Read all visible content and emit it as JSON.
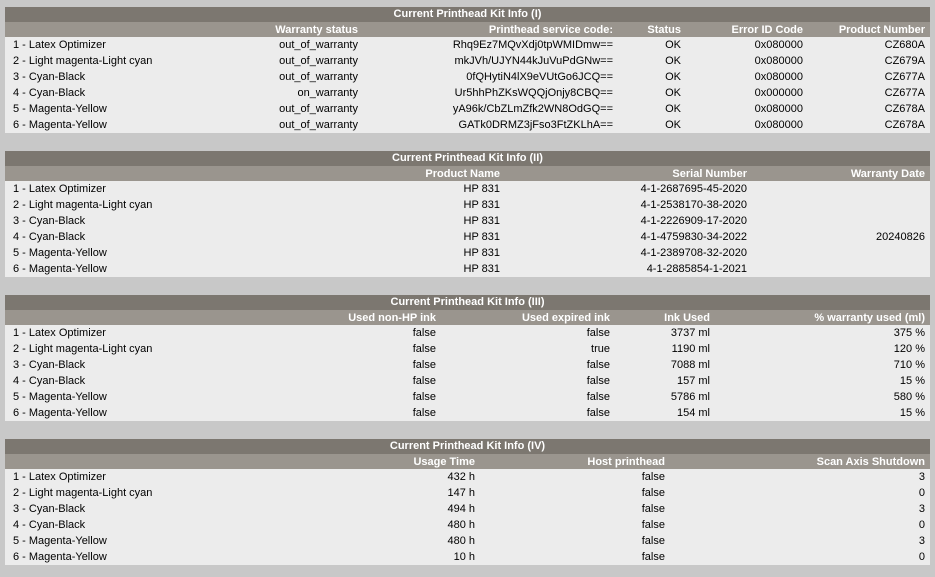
{
  "panel1": {
    "title": "Current Printhead Kit Info (I)",
    "headers": [
      "",
      "Warranty status",
      "Printhead service code:",
      "Status",
      "Error ID Code",
      "Product Number"
    ],
    "rows": [
      [
        "1 - Latex Optimizer",
        "out_of_warranty",
        "Rhq9Ez7MQvXdj0tpWMIDmw==",
        "OK",
        "0x080000",
        "CZ680A"
      ],
      [
        "2 - Light magenta-Light cyan",
        "out_of_warranty",
        "mkJVh/UJYN44kJuVuPdGNw==",
        "OK",
        "0x080000",
        "CZ679A"
      ],
      [
        "3 - Cyan-Black",
        "out_of_warranty",
        "0fQHytiN4lX9eVUtGo6JCQ==",
        "OK",
        "0x080000",
        "CZ677A"
      ],
      [
        "4 - Cyan-Black",
        "on_warranty",
        "Ur5hhPhZKsWQQjOnjy8CBQ==",
        "OK",
        "0x000000",
        "CZ677A"
      ],
      [
        "5 - Magenta-Yellow",
        "out_of_warranty",
        "yA96k/CbZLmZfk2WN8OdGQ==",
        "OK",
        "0x080000",
        "CZ678A"
      ],
      [
        "6 - Magenta-Yellow",
        "out_of_warranty",
        "GATk0DRMZ3jFso3FtZKLhA==",
        "OK",
        "0x080000",
        "CZ678A"
      ]
    ]
  },
  "panel2": {
    "title": "Current Printhead Kit Info (II)",
    "headers": [
      "",
      "Product Name",
      "Serial Number",
      "Warranty Date"
    ],
    "rows": [
      [
        "1 - Latex Optimizer",
        "HP 831",
        "4-1-2687695-45-2020",
        ""
      ],
      [
        "2 - Light magenta-Light cyan",
        "HP 831",
        "4-1-2538170-38-2020",
        ""
      ],
      [
        "3 - Cyan-Black",
        "HP 831",
        "4-1-2226909-17-2020",
        ""
      ],
      [
        "4 - Cyan-Black",
        "HP 831",
        "4-1-4759830-34-2022",
        "20240826"
      ],
      [
        "5 - Magenta-Yellow",
        "HP 831",
        "4-1-2389708-32-2020",
        ""
      ],
      [
        "6 - Magenta-Yellow",
        "HP 831",
        "4-1-2885854-1-2021",
        ""
      ]
    ]
  },
  "panel3": {
    "title": "Current Printhead Kit Info (III)",
    "headers": [
      "",
      "Used non-HP ink",
      "Used expired ink",
      "Ink Used",
      "% warranty used (ml)"
    ],
    "rows": [
      [
        "1 - Latex Optimizer",
        "false",
        "false",
        "3737 ml",
        "375 %"
      ],
      [
        "2 - Light magenta-Light cyan",
        "false",
        "true",
        "1190 ml",
        "120 %"
      ],
      [
        "3 - Cyan-Black",
        "false",
        "false",
        "7088 ml",
        "710 %"
      ],
      [
        "4 - Cyan-Black",
        "false",
        "false",
        "157 ml",
        "15 %"
      ],
      [
        "5 - Magenta-Yellow",
        "false",
        "false",
        "5786 ml",
        "580 %"
      ],
      [
        "6 - Magenta-Yellow",
        "false",
        "false",
        "154 ml",
        "15 %"
      ]
    ]
  },
  "panel4": {
    "title": "Current Printhead Kit Info (IV)",
    "headers": [
      "",
      "Usage Time",
      "Host printhead",
      "Scan Axis Shutdown"
    ],
    "rows": [
      [
        "1 - Latex Optimizer",
        "432 h",
        "false",
        "3"
      ],
      [
        "2 - Light magenta-Light cyan",
        "147 h",
        "false",
        "0"
      ],
      [
        "3 - Cyan-Black",
        "494 h",
        "false",
        "3"
      ],
      [
        "4 - Cyan-Black",
        "480 h",
        "false",
        "0"
      ],
      [
        "5 - Magenta-Yellow",
        "480 h",
        "false",
        "3"
      ],
      [
        "6 - Magenta-Yellow",
        "10 h",
        "false",
        "0"
      ]
    ]
  }
}
